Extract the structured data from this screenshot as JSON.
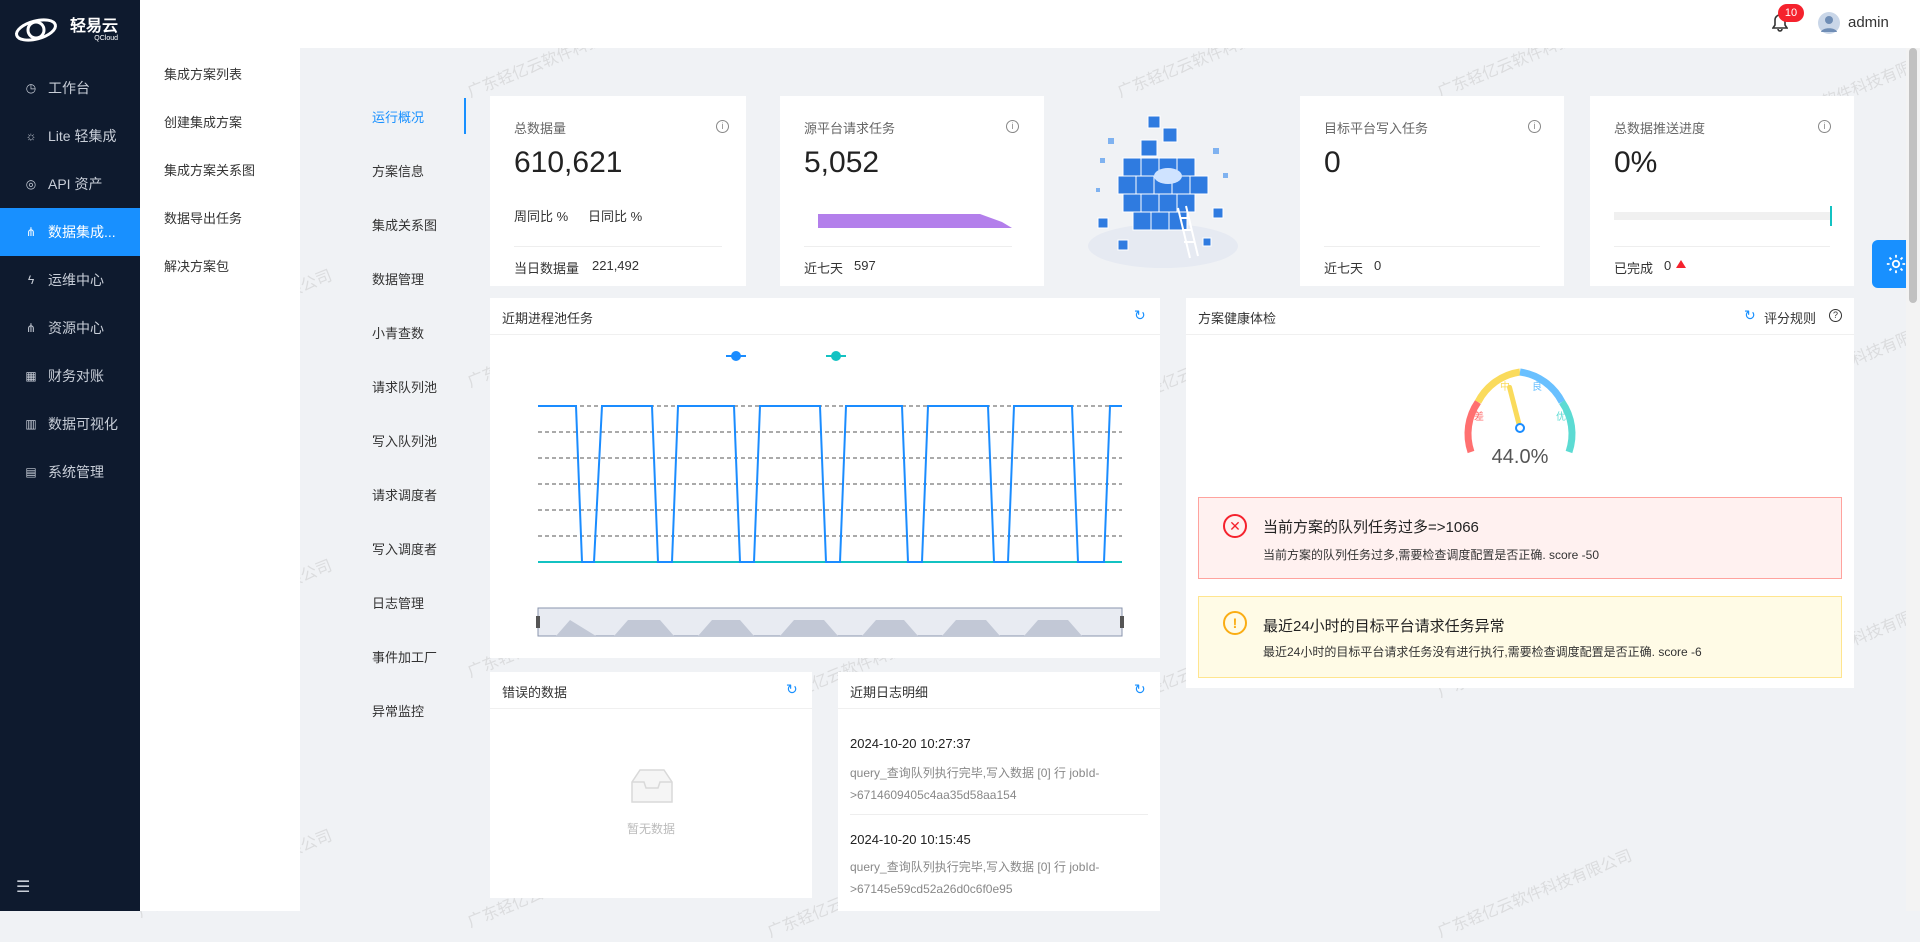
{
  "brand": {
    "name": "轻易云",
    "sub": "QCloud"
  },
  "sidebar": {
    "items": [
      {
        "label": "工作台",
        "icon": "clock-icon"
      },
      {
        "label": "Lite 轻集成",
        "icon": "bulb-icon"
      },
      {
        "label": "API 资产",
        "icon": "compass-icon"
      },
      {
        "label": "数据集成...",
        "icon": "cluster-icon",
        "active": true
      },
      {
        "label": "运维中心",
        "icon": "bolt-icon"
      },
      {
        "label": "资源中心",
        "icon": "cluster-icon"
      },
      {
        "label": "财务对账",
        "icon": "calculator-icon"
      },
      {
        "label": "数据可视化",
        "icon": "bar-chart-icon"
      },
      {
        "label": "系统管理",
        "icon": "grid-icon"
      }
    ]
  },
  "subnav": {
    "items": [
      "集成方案列表",
      "创建集成方案",
      "集成方案关系图",
      "数据导出任务",
      "解决方案包"
    ]
  },
  "header": {
    "badge": "10",
    "user": "admin"
  },
  "tabs": {
    "items": [
      "运行概况",
      "方案信息",
      "集成关系图",
      "数据管理",
      "小青查数",
      "请求队列池",
      "写入队列池",
      "请求调度者",
      "写入调度者",
      "日志管理",
      "事件加工厂",
      "异常监控"
    ]
  },
  "stats": {
    "total": {
      "label": "总数据量",
      "value": "610,621",
      "wow": "周同比 %",
      "dod": "日同比 %",
      "footer_label": "当日数据量",
      "footer_value": "221,492"
    },
    "source": {
      "label": "源平台请求任务",
      "value": "5,052",
      "footer_label": "近七天",
      "footer_value": "597"
    },
    "target": {
      "label": "目标平台写入任务",
      "value": "0",
      "footer_label": "近七天",
      "footer_value": "0"
    },
    "progress": {
      "label": "总数据推送进度",
      "value": "0%",
      "fraction": 0,
      "footer_label": "已完成",
      "footer_value": "0"
    }
  },
  "process_panel": {
    "title": "近期进程池任务"
  },
  "health": {
    "title": "方案健康体检",
    "rule_label": "评分规则",
    "score": "44.0%",
    "score_value": 44.0,
    "gauge_labels": [
      "差",
      "中",
      "良",
      "优"
    ],
    "alerts": [
      {
        "type": "error",
        "title": "当前方案的队列任务过多=>1066",
        "desc": "当前方案的队列任务过多,需要检查调度配置是否正确. score -50"
      },
      {
        "type": "warning",
        "title": "最近24小时的目标平台请求任务异常",
        "desc": "最近24小时的目标平台请求任务没有进行执行,需要检查调度配置是否正确. score -6"
      }
    ]
  },
  "error_panel": {
    "title": "错误的数据",
    "empty": "暂无数据"
  },
  "log_panel": {
    "title": "近期日志明细",
    "entries": [
      {
        "time": "2024-10-20 10:27:37",
        "text1": "query_查询队列执行完毕,写入数据 [0] 行 jobId-",
        "text2": ">6714609405c4aa35d58aa154"
      },
      {
        "time": "2024-10-20 10:15:45",
        "text1": "query_查询队列执行完毕,写入数据 [0] 行 jobId-",
        "text2": ">67145e59cd52a26d0c6f0e95"
      }
    ]
  },
  "watermark": "广东轻亿云软件科技有限公司",
  "colors": {
    "accent": "#1890ff",
    "sidebar": "#0e1a2e",
    "series1": "#1a8cff",
    "series2": "#13c2c2"
  }
}
